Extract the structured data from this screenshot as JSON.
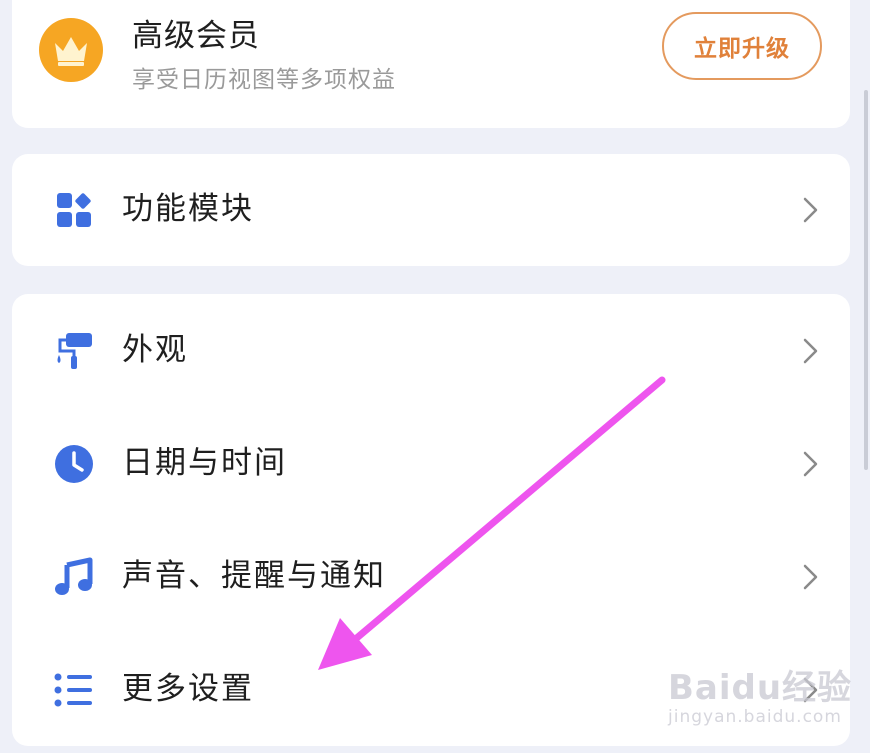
{
  "vip": {
    "title": "高级会员",
    "subtitle": "享受日历视图等多项权益",
    "upgrade_label": "立即升级",
    "icon": "crown-icon"
  },
  "modules": {
    "label": "功能模块",
    "icon": "grid-modules-icon"
  },
  "settings": {
    "items": [
      {
        "label": "外观",
        "icon": "paint-roller-icon"
      },
      {
        "label": "日期与时间",
        "icon": "clock-icon"
      },
      {
        "label": "声音、提醒与通知",
        "icon": "music-note-icon"
      },
      {
        "label": "更多设置",
        "icon": "list-icon"
      }
    ]
  },
  "watermark": {
    "brand": "Baidu经验",
    "url": "jingyan.baidu.com"
  },
  "colors": {
    "accent_blue": "#3f6fe0",
    "vip_orange": "#f6a623",
    "upgrade_orange": "#e0813a",
    "annotation_arrow": "#ee55ee"
  }
}
